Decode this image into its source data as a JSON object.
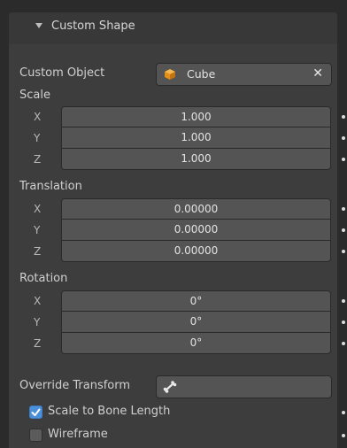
{
  "panel": {
    "header_label": "Custom Shape",
    "custom_object": {
      "label": "Custom Object",
      "value": "Cube",
      "icon": "cube-icon",
      "clear_glyph": "✕"
    },
    "scale": {
      "label": "Scale",
      "rows": [
        {
          "axis": "X",
          "value": "1.000"
        },
        {
          "axis": "Y",
          "value": "1.000"
        },
        {
          "axis": "Z",
          "value": "1.000"
        }
      ]
    },
    "translation": {
      "label": "Translation",
      "rows": [
        {
          "axis": "X",
          "value": "0.00000"
        },
        {
          "axis": "Y",
          "value": "0.00000"
        },
        {
          "axis": "Z",
          "value": "0.00000"
        }
      ]
    },
    "rotation": {
      "label": "Rotation",
      "rows": [
        {
          "axis": "X",
          "value": "0°"
        },
        {
          "axis": "Y",
          "value": "0°"
        },
        {
          "axis": "Z",
          "value": "0°"
        }
      ]
    },
    "override_transform": {
      "label": "Override Transform",
      "icon": "bone-icon",
      "value": ""
    },
    "scale_to_bone_length": {
      "label": "Scale to Bone Length",
      "checked": true
    },
    "wireframe": {
      "label": "Wireframe",
      "checked": false
    }
  },
  "colors": {
    "background": "#2b2b2b",
    "panel": "#3d3d3d",
    "field": "#545454",
    "checkbox_accent": "#4a8fd8",
    "cube_icon": "#f0a020"
  }
}
